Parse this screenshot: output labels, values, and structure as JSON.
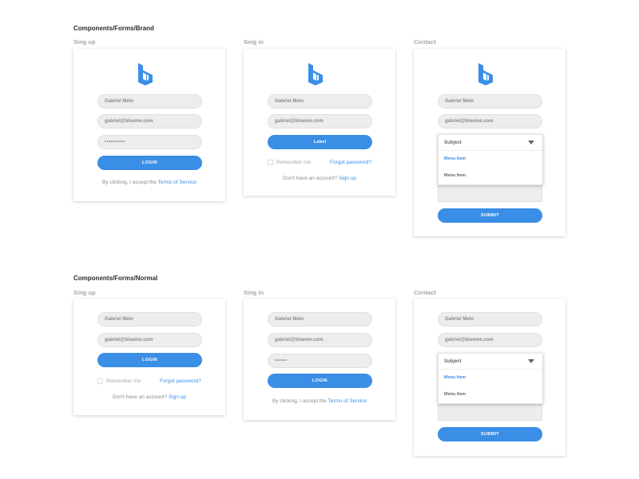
{
  "sections": {
    "brand_title": "Components/Forms/Brand",
    "normal_title": "Components/Forms/Normal"
  },
  "labels": {
    "signup": "Sing up",
    "signin": "Sing in",
    "contact": "Contact"
  },
  "fields": {
    "name": "Gabriel Melo",
    "email": "gabriel@blueme.com",
    "password_long": "••••••••••",
    "password_short": "••••••",
    "subject": "Subject"
  },
  "buttons": {
    "login": "LOGIN",
    "label": "Label",
    "submit": "SUBMIT"
  },
  "text": {
    "by_clicking": "By clicking, I accept the",
    "terms": "Terms of Service",
    "remember": "Remember me",
    "forgot": "Forgot password?",
    "no_account": "Don't have an account?",
    "signup_link": "Sign up"
  },
  "menu": {
    "item1": "Menu Item",
    "item2": "Menu Item"
  },
  "colors": {
    "accent": "#3a8ee6"
  },
  "icons": {
    "brand_logo": "blueme-logo-icon"
  }
}
